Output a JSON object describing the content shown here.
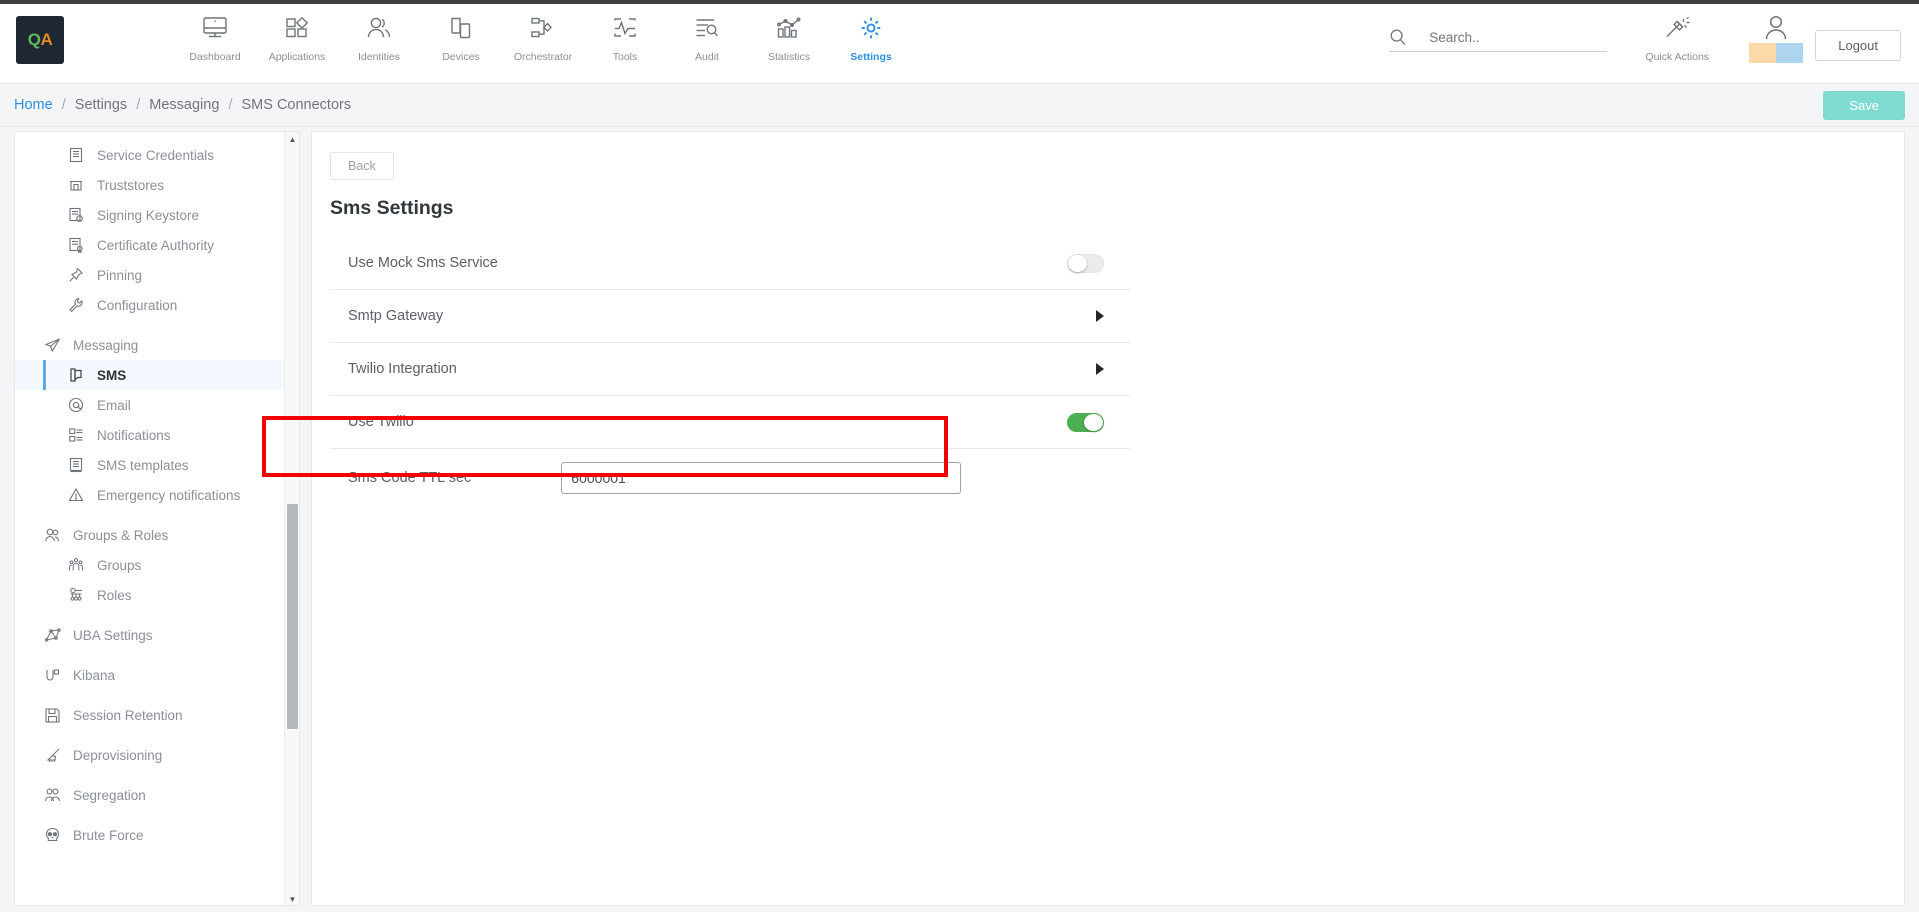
{
  "brand": {
    "logo_text_q": "Q",
    "logo_text_a": "A",
    "logo_bg": "#1f2733"
  },
  "colors": {
    "accent_blue": "#2f8fe0",
    "save_teal": "#7fdbd0",
    "toggle_on_green": "#4caf50",
    "highlight_red": "#f20000",
    "swatch_orange": "#fcd9a8",
    "swatch_blue": "#aed5f0"
  },
  "topnav": {
    "items": [
      {
        "label": "Dashboard",
        "icon": "monitor-icon",
        "active": false
      },
      {
        "label": "Applications",
        "icon": "apps-grid-icon",
        "active": false
      },
      {
        "label": "Identities",
        "icon": "users-icon",
        "active": false
      },
      {
        "label": "Devices",
        "icon": "devices-icon",
        "active": false
      },
      {
        "label": "Orchestrator",
        "icon": "orchestrator-icon",
        "active": false
      },
      {
        "label": "Tools",
        "icon": "pulse-icon",
        "active": false
      },
      {
        "label": "Audit",
        "icon": "audit-search-icon",
        "active": false
      },
      {
        "label": "Statistics",
        "icon": "bar-chart-icon",
        "active": false
      },
      {
        "label": "Settings",
        "icon": "gear-icon",
        "active": true
      }
    ],
    "search": {
      "placeholder": "Search..",
      "value": "",
      "icon": "search-icon"
    },
    "quick_actions": {
      "label": "Quick Actions",
      "icon": "magic-wand-icon"
    },
    "avatar": {
      "icon": "user-avatar-icon"
    },
    "logout_label": "Logout"
  },
  "breadcrumb": {
    "items": [
      "Home",
      "Settings",
      "Messaging",
      "SMS Connectors"
    ],
    "separator": "/"
  },
  "header_actions": {
    "save_label": "Save"
  },
  "sidebar": {
    "items": [
      {
        "label": "Service Credentials",
        "icon": "document-icon",
        "level": "sub",
        "active": false
      },
      {
        "label": "Truststores",
        "icon": "truststore-icon",
        "level": "sub",
        "active": false
      },
      {
        "label": "Signing Keystore",
        "icon": "signing-keystore-icon",
        "level": "sub",
        "active": false
      },
      {
        "label": "Certificate Authority",
        "icon": "certificate-icon",
        "level": "sub",
        "active": false
      },
      {
        "label": "Pinning",
        "icon": "pin-icon",
        "level": "sub",
        "active": false
      },
      {
        "label": "Configuration",
        "icon": "wrench-icon",
        "level": "sub",
        "active": false
      },
      {
        "label": "Messaging",
        "icon": "send-icon",
        "level": "group",
        "active": false
      },
      {
        "label": "SMS",
        "icon": "sms-icon",
        "level": "sub",
        "active": true
      },
      {
        "label": "Email",
        "icon": "at-icon",
        "level": "sub",
        "active": false
      },
      {
        "label": "Notifications",
        "icon": "notifications-icon",
        "level": "sub",
        "active": false
      },
      {
        "label": "SMS templates",
        "icon": "template-icon",
        "level": "sub",
        "active": false
      },
      {
        "label": "Emergency notifications",
        "icon": "warning-icon",
        "level": "sub",
        "active": false
      },
      {
        "label": "Groups & Roles",
        "icon": "groups-roles-icon",
        "level": "group",
        "active": false
      },
      {
        "label": "Groups",
        "icon": "group-people-icon",
        "level": "sub",
        "active": false
      },
      {
        "label": "Roles",
        "icon": "roles-icon",
        "level": "sub",
        "active": false
      },
      {
        "label": "UBA Settings",
        "icon": "uba-graph-icon",
        "level": "group",
        "active": false
      },
      {
        "label": "Kibana",
        "icon": "kibana-icon",
        "level": "group",
        "active": false
      },
      {
        "label": "Session Retention",
        "icon": "save-disk-icon",
        "level": "group",
        "active": false
      },
      {
        "label": "Deprovisioning",
        "icon": "broom-icon",
        "level": "group",
        "active": false
      },
      {
        "label": "Segregation",
        "icon": "segregation-icon",
        "level": "group",
        "active": false
      },
      {
        "label": "Brute Force",
        "icon": "skull-icon",
        "level": "group",
        "active": false
      }
    ],
    "scrollbar": {
      "up_arrow": "▲",
      "down_arrow": "▼"
    }
  },
  "main": {
    "back_label": "Back",
    "title": "Sms Settings",
    "rows": [
      {
        "label": "Use Mock Sms Service",
        "control": "toggle",
        "state": "off"
      },
      {
        "label": "Smtp Gateway",
        "control": "caret",
        "state": "collapsed"
      },
      {
        "label": "Twilio Integration",
        "control": "caret",
        "state": "collapsed"
      },
      {
        "label": "Use Twilio",
        "control": "toggle",
        "state": "on",
        "highlighted": true
      },
      {
        "label": "Sms Code TTL sec",
        "control": "text-input",
        "value": "6000001"
      }
    ]
  }
}
